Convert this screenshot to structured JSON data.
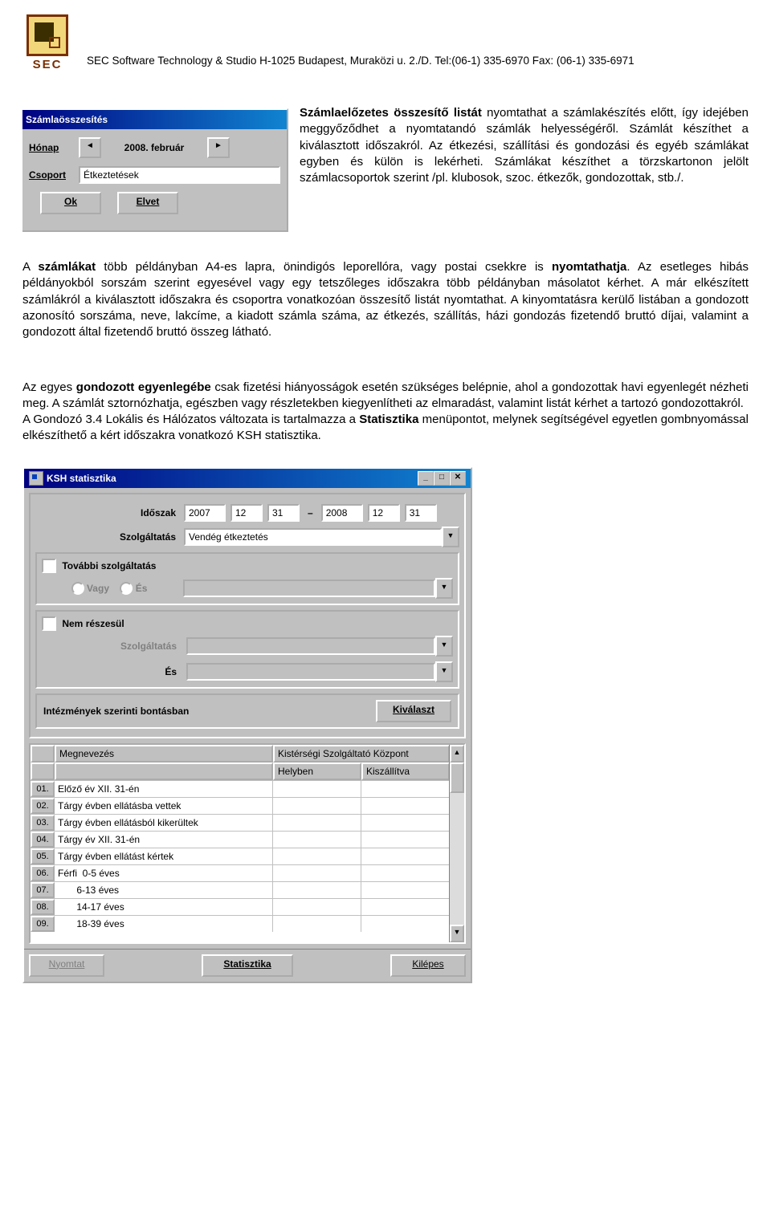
{
  "header": {
    "logo_text": "SEC",
    "line": "SEC Software Technology & Studio  H-1025 Budapest, Muraközi u. 2./D.  Tel:(06-1) 335-6970 Fax: (06-1) 335-6971"
  },
  "intro": {
    "lead_bold": "Számlaelőzetes összesítő listát",
    "para1_rest": " nyomtathat a számlakészítés előtt, így idejében meggyőződhet a nyomtatandó számlák helyességéről. Számlát készíthet a kiválasztott időszakról. Az étkezési, szállítási és gondozási és egyéb számlákat egyben és külön is lekérheti. Számlákat készíthet a törzskartonon jelölt számlacsoportok szerint /pl. klubosok, szoc. étkezők, gondozottak, stb./."
  },
  "dlg1": {
    "title": "Számlaösszesítés",
    "honap_label": "Hónap",
    "month_value": "2008. február",
    "csoport_label": "Csoport",
    "csoport_value": "Étkeztetések",
    "ok_label": "Ok",
    "cancel_label": "Elvet"
  },
  "para2": {
    "lead": "A ",
    "bold1": "számlákat",
    "rest1": " több példányban A4-es lapra, önindigós leporellóra, vagy postai csekkre is ",
    "bold2": "nyomtathatja",
    "rest2": ". Az esetleges hibás példányokból sorszám szerint egyesével vagy egy tetszőleges időszakra több példányban másolatot kérhet. A már elkészített számlákról a kiválasztott időszakra és csoportra vonatkozóan összesítő listát nyomtathat. A kinyomtatásra kerülő listában a gondozott azonosító sorszáma, neve, lakcíme, a kiadott számla száma, az étkezés, szállítás, házi gondozás fizetendő bruttó díjai, valamint a gondozott által fizetendő bruttó összeg látható."
  },
  "para3": {
    "lead": "Az egyes ",
    "bold1": "gondozott egyenlegébe",
    "rest1": " csak fizetési hiányosságok esetén szükséges belépnie, ahol a gondozottak havi egyenlegét nézheti meg. A számlát sztornózhatja, egészben vagy részletekben kiegyenlítheti az elmaradást, valamint listát kérhet a tartozó gondozottakról.\nA Gondozó 3.4 Lokális és Hálózatos változata is tartalmazza a ",
    "bold2": "Statisztika",
    "rest2": " menüpontot, melynek segítségével egyetlen gombnyomással elkészíthető a kért időszakra vonatkozó KSH statisztika."
  },
  "dlg2": {
    "title": "KSH statisztika",
    "idoszak_label": "Időszak",
    "d_from_y": "2007",
    "d_from_m": "12",
    "d_from_d": "31",
    "d_to_y": "2008",
    "d_to_m": "12",
    "d_to_d": "31",
    "szolg_label": "Szolgáltatás",
    "szolg_value": "Vendég étkeztetés",
    "tovabbi_label": "További szolgáltatás",
    "vagy_label": "Vagy",
    "es_label": "És",
    "nem_label": "Nem részesül",
    "sub_szolg_label": "Szolgáltatás",
    "sub_es_label": "És",
    "intezm_label": "Intézmények szerinti bontásban",
    "kivalaszt_label": "Kiválaszt",
    "col_megnev": "Megnevezés",
    "col_kozpont": "Kistérségi Szolgáltató Központ",
    "col_helyben": "Helyben",
    "col_kiszall": "Kiszállítva",
    "rows": [
      {
        "n": "01.",
        "t": "Előző év XII. 31-én"
      },
      {
        "n": "02.",
        "t": "Tárgy évben ellátásba vettek"
      },
      {
        "n": "03.",
        "t": "Tárgy évben ellátásból kikerültek"
      },
      {
        "n": "04.",
        "t": "Tárgy év XII. 31-én"
      },
      {
        "n": "05.",
        "t": "Tárgy évben ellátást kértek"
      },
      {
        "n": "06.",
        "t": "Férfi  0-5 éves"
      },
      {
        "n": "07.",
        "t": "       6-13 éves"
      },
      {
        "n": "08.",
        "t": "       14-17 éves"
      },
      {
        "n": "09.",
        "t": "       18-39 éves"
      }
    ],
    "btn_nyomtat": "Nyomtat",
    "btn_stat": "Statisztika",
    "btn_kilepes": "Kilépes"
  }
}
